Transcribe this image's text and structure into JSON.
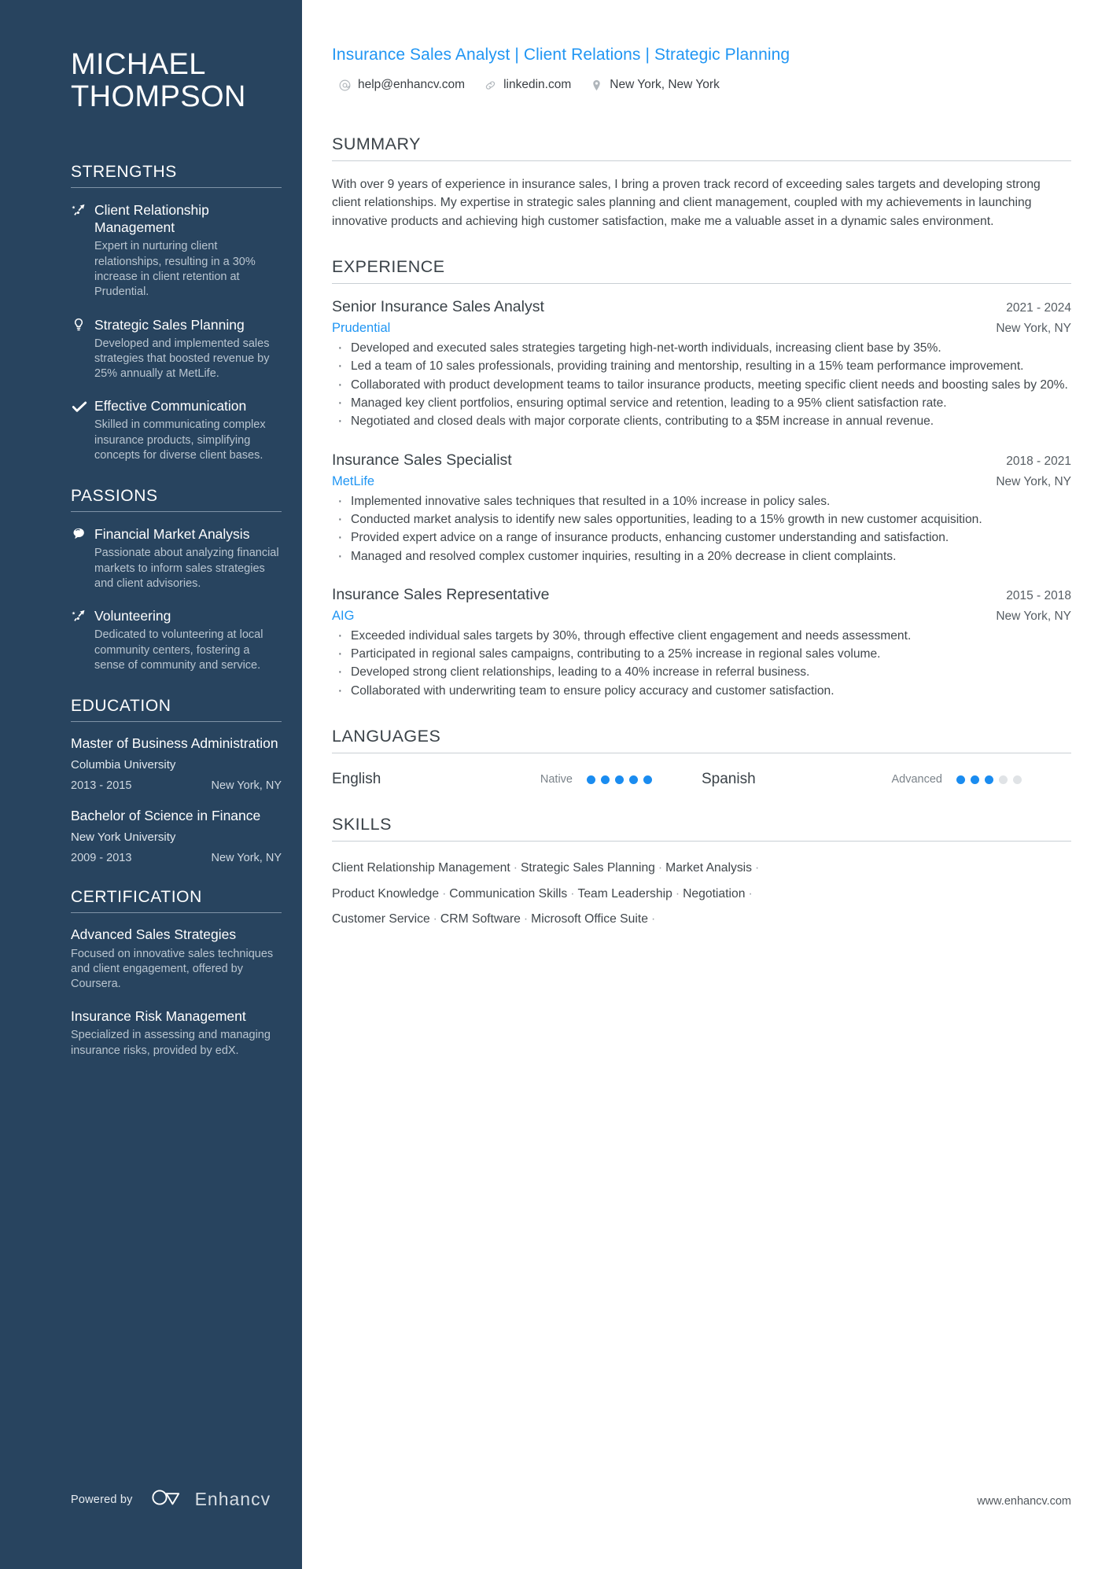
{
  "colors": {
    "sidebar_bg": "#28445f",
    "accent_blue": "#2196f3",
    "dot_on": "#1a8cf0",
    "dot_off": "#e0e3e6"
  },
  "sidebar": {
    "name_first": "MICHAEL",
    "name_last": "THOMPSON",
    "strengths": {
      "heading": "STRENGTHS",
      "items": [
        {
          "icon": "growth-arrow-icon",
          "title": "Client Relationship Management",
          "desc": "Expert in nurturing client relationships, resulting in a 30% increase in client retention at Prudential."
        },
        {
          "icon": "lightbulb-icon",
          "title": "Strategic Sales Planning",
          "desc": "Developed and implemented sales strategies that boosted revenue by 25% annually at MetLife."
        },
        {
          "icon": "checkmark-icon",
          "title": "Effective Communication",
          "desc": "Skilled in communicating complex insurance products, simplifying concepts for diverse client bases."
        }
      ]
    },
    "passions": {
      "heading": "PASSIONS",
      "items": [
        {
          "icon": "speech-bubble-icon",
          "title": "Financial Market Analysis",
          "desc": "Passionate about analyzing financial markets to inform sales strategies and client advisories."
        },
        {
          "icon": "growth-arrow-icon",
          "title": "Volunteering",
          "desc": "Dedicated to volunteering at local community centers, fostering a sense of community and service."
        }
      ]
    },
    "education": {
      "heading": "EDUCATION",
      "items": [
        {
          "degree": "Master of Business Administration",
          "school": "Columbia University",
          "dates": "2013 - 2015",
          "location": "New York, NY"
        },
        {
          "degree": "Bachelor of Science in Finance",
          "school": "New York University",
          "dates": "2009 - 2013",
          "location": "New York, NY"
        }
      ]
    },
    "certification": {
      "heading": "CERTIFICATION",
      "items": [
        {
          "title": "Advanced Sales Strategies",
          "desc": "Focused on innovative sales techniques and client engagement, offered by Coursera."
        },
        {
          "title": "Insurance Risk Management",
          "desc": "Specialized in assessing and managing insurance risks, provided by edX."
        }
      ]
    },
    "footer": {
      "powered_by": "Powered by",
      "brand": "Enhancv",
      "logo_icon": "enhancv-logo-icon"
    }
  },
  "main": {
    "headline": "Insurance Sales Analyst | Client Relations | Strategic Planning",
    "contacts": [
      {
        "icon": "at-sign-icon",
        "text": "help@enhancv.com"
      },
      {
        "icon": "link-icon",
        "text": "linkedin.com"
      },
      {
        "icon": "map-pin-icon",
        "text": "New York, New York"
      }
    ],
    "summary": {
      "heading": "SUMMARY",
      "text": "With over 9 years of experience in insurance sales, I bring a proven track record of exceeding sales targets and developing strong client relationships. My expertise in strategic sales planning and client management, coupled with my achievements in launching innovative products and achieving high customer satisfaction, make me a valuable asset in a dynamic sales environment."
    },
    "experience": {
      "heading": "EXPERIENCE",
      "jobs": [
        {
          "title": "Senior Insurance Sales Analyst",
          "dates": "2021 - 2024",
          "company": "Prudential",
          "location": "New York, NY",
          "bullets": [
            "Developed and executed sales strategies targeting high-net-worth individuals, increasing client base by 35%.",
            "Led a team of 10 sales professionals, providing training and mentorship, resulting in a 15% team performance improvement.",
            "Collaborated with product development teams to tailor insurance products, meeting specific client needs and boosting sales by 20%.",
            "Managed key client portfolios, ensuring optimal service and retention, leading to a 95% client satisfaction rate.",
            "Negotiated and closed deals with major corporate clients, contributing to a $5M increase in annual revenue."
          ]
        },
        {
          "title": "Insurance Sales Specialist",
          "dates": "2018 - 2021",
          "company": "MetLife",
          "location": "New York, NY",
          "bullets": [
            "Implemented innovative sales techniques that resulted in a 10% increase in policy sales.",
            "Conducted market analysis to identify new sales opportunities, leading to a 15% growth in new customer acquisition.",
            "Provided expert advice on a range of insurance products, enhancing customer understanding and satisfaction.",
            "Managed and resolved complex customer inquiries, resulting in a 20% decrease in client complaints."
          ]
        },
        {
          "title": "Insurance Sales Representative",
          "dates": "2015 - 2018",
          "company": "AIG",
          "location": "New York, NY",
          "bullets": [
            "Exceeded individual sales targets by 30%, through effective client engagement and needs assessment.",
            "Participated in regional sales campaigns, contributing to a 25% increase in regional sales volume.",
            "Developed strong client relationships, leading to a 40% increase in referral business.",
            "Collaborated with underwriting team to ensure policy accuracy and customer satisfaction."
          ]
        }
      ]
    },
    "languages": {
      "heading": "LANGUAGES",
      "items": [
        {
          "name": "English",
          "level": "Native",
          "filled": 5,
          "total": 5
        },
        {
          "name": "Spanish",
          "level": "Advanced",
          "filled": 3,
          "total": 5
        }
      ]
    },
    "skills": {
      "heading": "SKILLS",
      "lines": [
        [
          "Client Relationship Management",
          "Strategic Sales Planning",
          "Market Analysis"
        ],
        [
          "Product Knowledge",
          "Communication Skills",
          "Team Leadership",
          "Negotiation"
        ],
        [
          "Customer Service",
          "CRM Software",
          "Microsoft Office Suite"
        ]
      ],
      "separator": "·"
    },
    "footer_url": "www.enhancv.com"
  }
}
